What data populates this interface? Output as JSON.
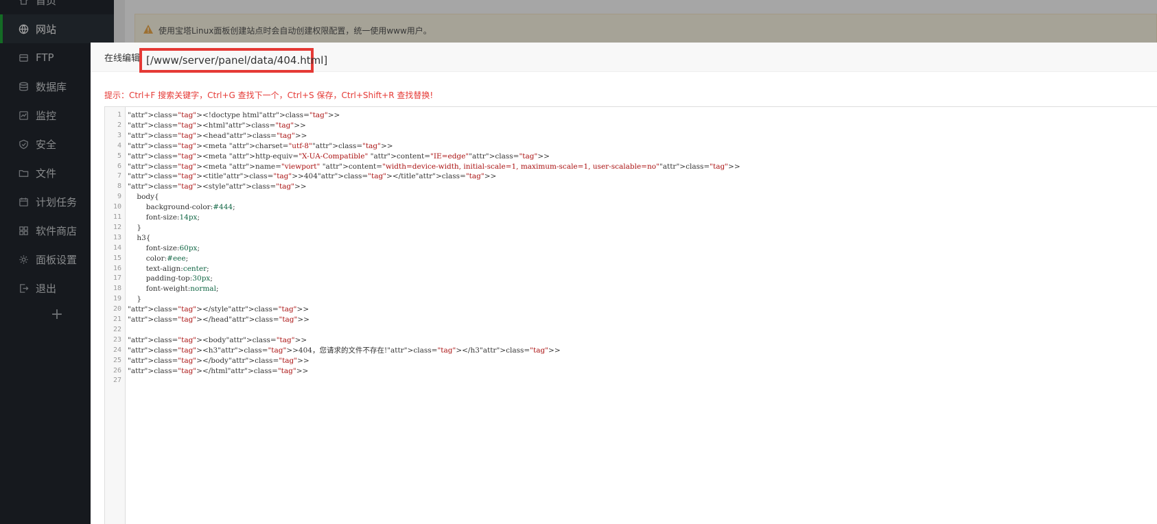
{
  "sidebar": {
    "items": [
      {
        "label": "首页",
        "icon": "home-icon"
      },
      {
        "label": "网站",
        "icon": "globe-icon",
        "active": true
      },
      {
        "label": "FTP",
        "icon": "ftp-icon"
      },
      {
        "label": "数据库",
        "icon": "database-icon"
      },
      {
        "label": "监控",
        "icon": "monitor-icon"
      },
      {
        "label": "安全",
        "icon": "shield-icon"
      },
      {
        "label": "文件",
        "icon": "folder-icon"
      },
      {
        "label": "计划任务",
        "icon": "calendar-icon"
      },
      {
        "label": "软件商店",
        "icon": "grid-icon"
      },
      {
        "label": "面板设置",
        "icon": "gear-icon"
      },
      {
        "label": "退出",
        "icon": "logout-icon"
      }
    ],
    "add_label": "+"
  },
  "notice": {
    "text": "使用宝塔Linux面板创建站点时会自动创建权限配置，统一使用www用户。",
    "icon": "warning-icon"
  },
  "modal": {
    "title_prefix": "在线编辑",
    "path": "[/www/server/panel/data/404.html]",
    "hint": "提示：Ctrl+F 搜索关键字，Ctrl+G 查找下一个，Ctrl+S 保存，Ctrl+Shift+R 查找替换!"
  },
  "editor": {
    "lines": [
      "<!doctype html>",
      "<html>",
      "<head>",
      "<meta charset=\"utf-8\">",
      "<meta http-equiv=\"X-UA-Compatible\" content=\"IE=edge\">",
      "<meta name=\"viewport\" content=\"width=device-width, initial-scale=1, maximum-scale=1, user-scalable=no\">",
      "<title>404</title>",
      "<style>",
      "    body{",
      "        background-color:#444;",
      "        font-size:14px;",
      "    }",
      "    h3{",
      "        font-size:60px;",
      "        color:#eee;",
      "        text-align:center;",
      "        padding-top:30px;",
      "        font-weight:normal;",
      "    }",
      "</style>",
      "</head>",
      "",
      "<body>",
      "<h3>404，您请求的文件不存在!</h3>",
      "</body>",
      "</html>",
      ""
    ]
  },
  "colors": {
    "sidebar_bg": "#22272e",
    "accent": "#20a53a",
    "highlight": "#e53935"
  }
}
